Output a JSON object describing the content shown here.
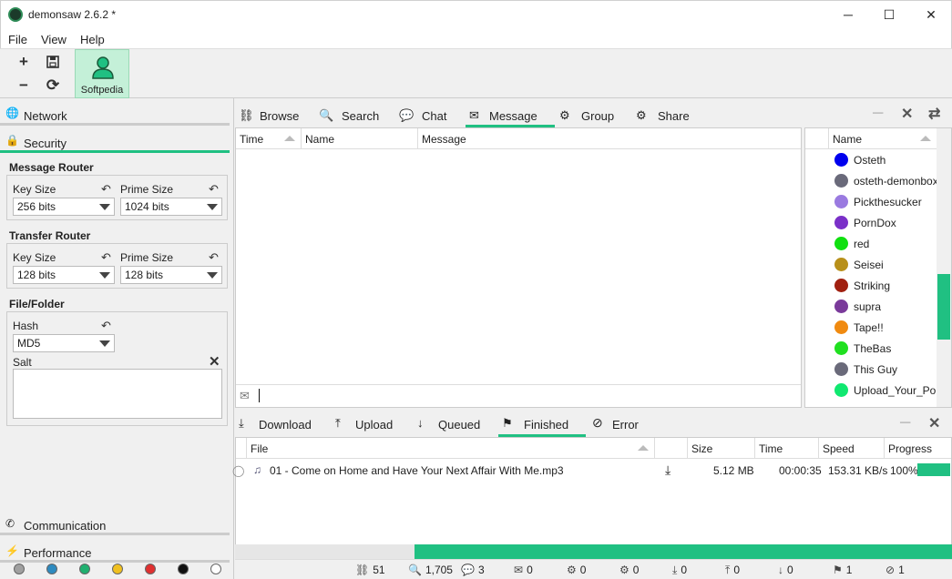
{
  "window": {
    "title": "demonsaw 2.6.2 *",
    "minimize": "─",
    "maximize": "☐",
    "close": "✕"
  },
  "menu": {
    "file": "File",
    "view": "View",
    "help": "Help"
  },
  "toolbar": {
    "add": "+",
    "save": "💾",
    "remove": "−",
    "refresh": "⟳",
    "profile_label": "Softpedia"
  },
  "sidebar": {
    "network": "Network",
    "security": "Security",
    "communication": "Communication",
    "performance": "Performance",
    "message_router": {
      "title": "Message Router",
      "key_size_label": "Key Size",
      "key_size_value": "256 bits",
      "prime_size_label": "Prime Size",
      "prime_size_value": "1024 bits"
    },
    "transfer_router": {
      "title": "Transfer Router",
      "key_size_label": "Key Size",
      "key_size_value": "128 bits",
      "prime_size_label": "Prime Size",
      "prime_size_value": "128 bits"
    },
    "file_folder": {
      "title": "File/Folder",
      "hash_label": "Hash",
      "hash_value": "MD5",
      "salt_label": "Salt",
      "salt_value": ""
    },
    "colors": [
      "#a0a0a0",
      "#2e8bc0",
      "#20b070",
      "#f0c020",
      "#e03030",
      "#101010",
      "#ffffff"
    ]
  },
  "tabs": {
    "browse": "Browse",
    "search": "Search",
    "chat": "Chat",
    "message": "Message",
    "group": "Group",
    "share": "Share"
  },
  "message_table": {
    "col_time": "Time",
    "col_name": "Name",
    "col_message": "Message"
  },
  "users": {
    "col_name": "Name",
    "list": [
      {
        "name": "Osteth",
        "color": "#0000ee"
      },
      {
        "name": "osteth-demonbox",
        "color": "#6a6a7a"
      },
      {
        "name": "Pickthesucker",
        "color": "#9a7ae0"
      },
      {
        "name": "PornDox",
        "color": "#7a30c8"
      },
      {
        "name": "red",
        "color": "#10e010"
      },
      {
        "name": "Seisei",
        "color": "#b8901a"
      },
      {
        "name": "Striking",
        "color": "#a02010"
      },
      {
        "name": "supra",
        "color": "#7a3a9a"
      },
      {
        "name": "Tape!!",
        "color": "#f08a10"
      },
      {
        "name": "TheBas",
        "color": "#20e020"
      },
      {
        "name": "This Guy",
        "color": "#6a6a7a"
      },
      {
        "name": "Upload_Your_Porn",
        "color": "#10e870"
      }
    ]
  },
  "transfer_tabs": {
    "download": "Download",
    "upload": "Upload",
    "queued": "Queued",
    "finished": "Finished",
    "error": "Error"
  },
  "file_table": {
    "col_file": "File",
    "col_size": "Size",
    "col_time": "Time",
    "col_speed": "Speed",
    "col_progress": "Progress",
    "rows": [
      {
        "file": "01 - Come on Home and Have Your Next Affair With Me.mp3",
        "size": "5.12 MB",
        "time": "00:00:35",
        "speed": "153.31 KB/s",
        "progress": "100%"
      }
    ]
  },
  "status": {
    "routers": "51",
    "searches": "1,705",
    "chats": "3",
    "messages": "0",
    "groups": "0",
    "shares": "0",
    "downloads": "0",
    "uploads": "0",
    "queued": "0",
    "finished": "1",
    "errors": "1"
  },
  "progress_overall": 0.75
}
